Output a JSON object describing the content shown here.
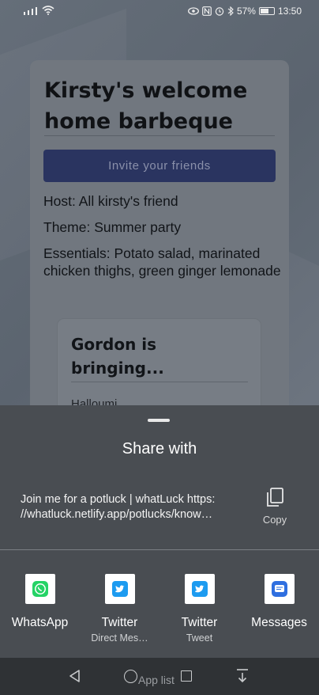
{
  "status_bar": {
    "battery": "57%",
    "time": "13:50",
    "icons": [
      "signal-icon",
      "wifi-icon",
      "eye-icon",
      "nfc-icon",
      "alarm-icon",
      "bluetooth-icon",
      "battery-icon"
    ]
  },
  "event": {
    "title": "Kirsty's welcome home barbeque",
    "invite_label": "Invite your friends",
    "host_label": "Host:",
    "host_value": " All kirsty's friend",
    "theme_label": "Theme:",
    "theme_value": " Summer party",
    "essentials_label": "Essentials:",
    "essentials_value": " Potato salad, marinated chicken thighs, green ginger lemonade"
  },
  "bringing": {
    "title": "Gordon is bringing...",
    "first_item": "Halloumi"
  },
  "share_sheet": {
    "title": "Share with",
    "text_line1": "Join me for a potluck | whatLuck https:",
    "text_line2": "//whatluck.netlify.app/potlucks/know…",
    "copy_label": "Copy",
    "targets": [
      {
        "label": "WhatsApp",
        "sub": "",
        "icon": "whatsapp-icon",
        "color": "#25d366"
      },
      {
        "label": "Twitter",
        "sub": "Direct Mes…",
        "icon": "twitter-icon",
        "color": "#1d9bf0"
      },
      {
        "label": "Twitter",
        "sub": "Tweet",
        "icon": "twitter-icon",
        "color": "#1d9bf0"
      },
      {
        "label": "Messages",
        "sub": "",
        "icon": "messages-icon",
        "color": "#2f6fe0"
      }
    ]
  },
  "nav_bar": {
    "home_label": "App list"
  }
}
